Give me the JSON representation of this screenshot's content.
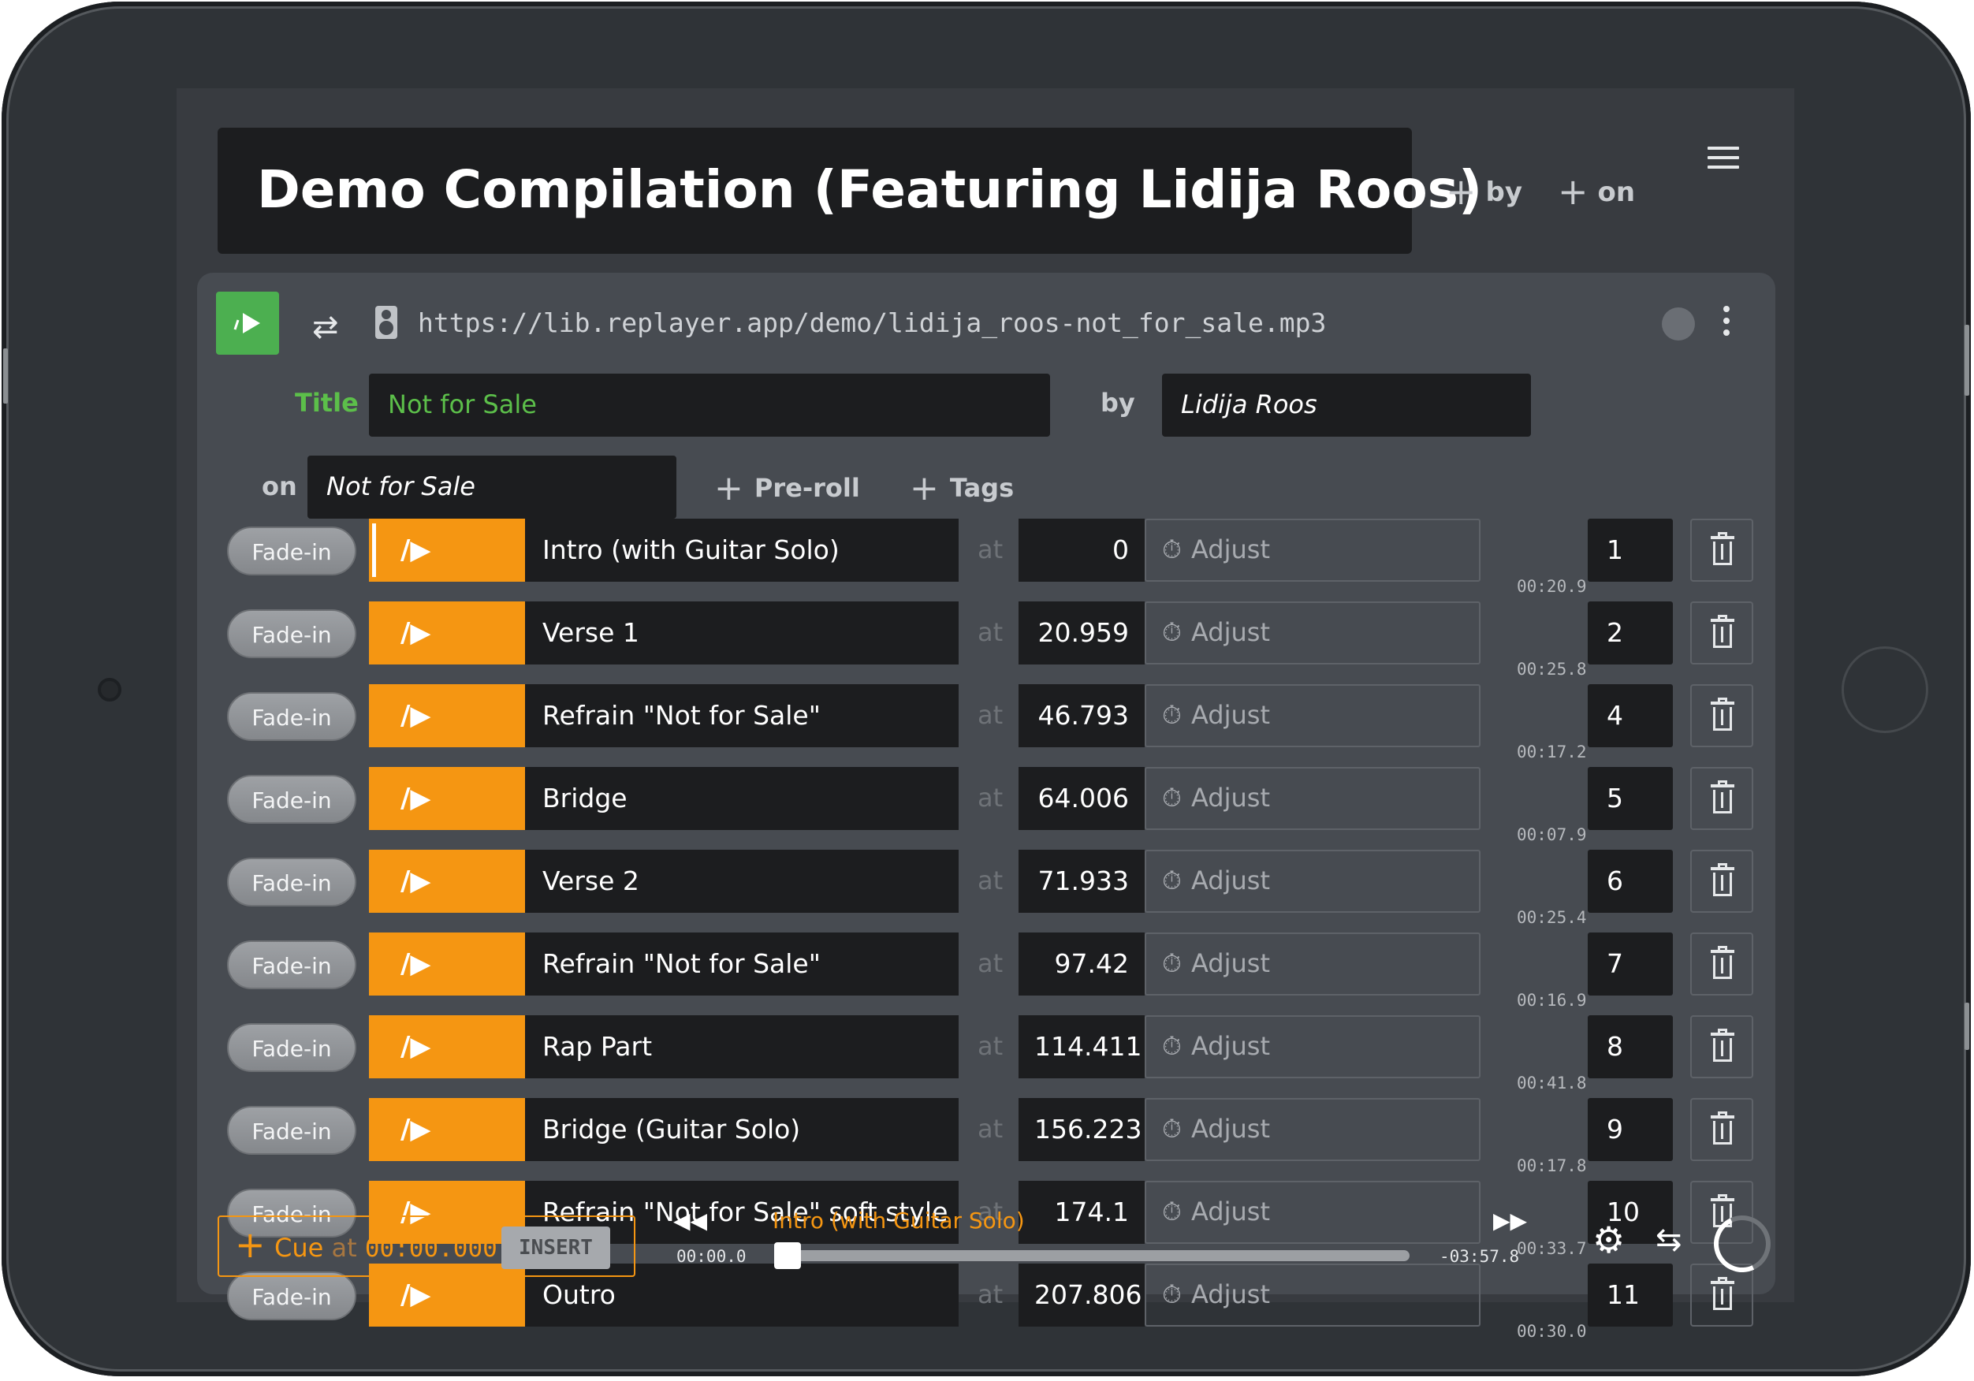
{
  "header": {
    "title": "Demo Compilation (Featuring Lidija Roos)",
    "add_by_label": "by",
    "add_on_label": "on"
  },
  "track": {
    "url": "https://lib.replayer.app/demo/lidija_roos-not_for_sale.mp3",
    "title_label": "Title",
    "title_value": "Not for Sale",
    "by_label": "by",
    "artist_value": "Lidija Roos",
    "on_label": "on",
    "album_value": "Not for Sale",
    "preroll_label": "Pre-roll",
    "tags_label": "Tags"
  },
  "cue_labels": {
    "fade": "Fade-in",
    "at": "at",
    "adjust": "Adjust"
  },
  "cues": [
    {
      "name": "Intro (with Guitar Solo)",
      "time": "0",
      "shortcut": "1",
      "duration": "00:20.9"
    },
    {
      "name": "Verse 1",
      "time": "20.959",
      "shortcut": "2",
      "duration": "00:25.8"
    },
    {
      "name": "Refrain \"Not for Sale\"",
      "time": "46.793",
      "shortcut": "4",
      "duration": "00:17.2"
    },
    {
      "name": "Bridge",
      "time": "64.006",
      "shortcut": "5",
      "duration": "00:07.9"
    },
    {
      "name": "Verse 2",
      "time": "71.933",
      "shortcut": "6",
      "duration": "00:25.4"
    },
    {
      "name": "Refrain \"Not for Sale\"",
      "time": "97.42",
      "shortcut": "7",
      "duration": "00:16.9"
    },
    {
      "name": "Rap Part",
      "time": "114.411",
      "shortcut": "8",
      "duration": "00:41.8"
    },
    {
      "name": "Bridge (Guitar Solo)",
      "time": "156.223",
      "shortcut": "9",
      "duration": "00:17.8"
    },
    {
      "name": "Refrain \"Not for Sale\" soft style",
      "time": "174.1",
      "shortcut": "10",
      "duration": "00:33.7"
    },
    {
      "name": "Outro",
      "time": "207.806",
      "shortcut": "11",
      "duration": "00:30.0"
    }
  ],
  "transport": {
    "cue_label": "Cue",
    "at_label": "at",
    "cue_position": "00:00.000",
    "insert_label": "INSERT",
    "current_track": "Intro (with Guitar Solo)",
    "elapsed": "00:00.0",
    "remaining": "-03:57.8",
    "progress_fraction": 0.0
  },
  "icons": {
    "menu": "hamburger-icon",
    "play": "play-icon",
    "swap": "swap-icon",
    "speaker": "speaker-icon",
    "more": "kebab-icon",
    "timer": "stopwatch-icon",
    "trash": "trash-icon",
    "rewind": "rewind-icon",
    "forward": "fast-forward-icon",
    "settings": "gear-icon",
    "loop": "repeat-icon",
    "loading": "spinner-icon"
  },
  "colors": {
    "accent": "#f59612",
    "play_green": "#4caf50",
    "title_green": "#5cbf4a"
  }
}
